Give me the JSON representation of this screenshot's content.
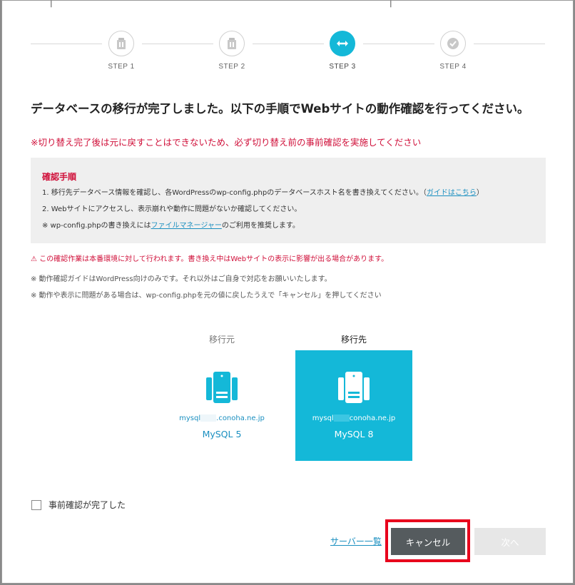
{
  "stepper": {
    "steps": [
      {
        "label": "STEP 1",
        "state": "done",
        "icon": "document-icon"
      },
      {
        "label": "STEP 2",
        "state": "done",
        "icon": "document-icon"
      },
      {
        "label": "STEP 3",
        "state": "active",
        "icon": "swap-arrows-icon"
      },
      {
        "label": "STEP 4",
        "state": "pending",
        "icon": "check-icon"
      }
    ]
  },
  "heading": "データベースの移行が完了しました。以下の手順でWebサイトの動作確認を行ってください。",
  "warning": "※切り替え完了後は元に戻すことはできないため、必ず切り替え前の事前確認を実施してください",
  "procedure": {
    "title": "確認手順",
    "line1_text": "1. 移行先データベース情報を確認し、各WordPressのwp-config.phpのデータベースホスト名を書き換えてください。（",
    "line1_link": "ガイドはこちら",
    "line1_end": "）",
    "line2_text": "2. Webサイトにアクセスし、表示崩れや動作に問題がないか確認してください。",
    "line3_text": "※ wp-config.phpの書き換えには",
    "line3_link": "ファイルマネージャー",
    "line3_end": "のご利用を推奨します。"
  },
  "caution": "⚠ この確認作業は本番環境に対して行われます。書き換え中はWebサイトの表示に影響が出る場合があります。",
  "notes": [
    "※ 動作確認ガイドはWordPress向けのみです。それ以外はご自身で対応をお願いいたします。",
    "※ 動作や表示に問題がある場合は、wp-config.phpを元の値に戻したうえで「キャンセル」を押してください"
  ],
  "source_db": {
    "label": "移行元",
    "host_prefix": "mysql",
    "host_suffix": ".conoha.ne.jp",
    "version": "MySQL 5"
  },
  "dest_db": {
    "label": "移行先",
    "host_prefix": "mysql",
    "host_suffix": "conoha.ne.jp",
    "version": "MySQL 8"
  },
  "checkbox": {
    "label": "事前確認が完了した",
    "checked": false
  },
  "footer": {
    "server_list_link": "サーバー一覧",
    "cancel_label": "キャンセル",
    "next_label": "次へ"
  },
  "colors": {
    "accent": "#14b8d8",
    "danger": "#d0103a",
    "link": "#1a8fc0",
    "highlight": "#e8001c"
  }
}
